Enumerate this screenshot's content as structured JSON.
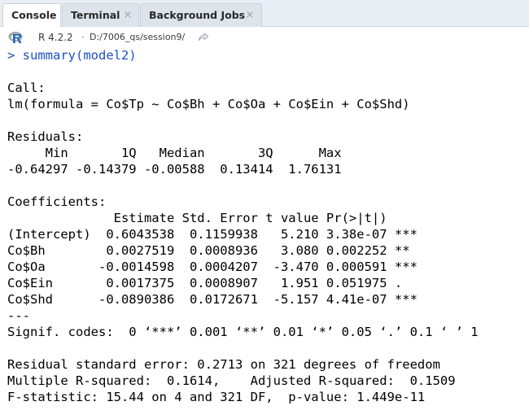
{
  "tabs": [
    {
      "label": "Console",
      "active": true,
      "closable": false
    },
    {
      "label": "Terminal",
      "active": false,
      "closable": true
    },
    {
      "label": "Background Jobs",
      "active": false,
      "closable": true
    }
  ],
  "path_bar": {
    "r_icon": "r-logo-icon",
    "version": "R 4.2.2",
    "separator": "·",
    "path": "D:/7006_qs/session9/",
    "nav_icon": "go-to-directory-icon"
  },
  "console": {
    "prompt_color": "#1d4fbf",
    "lines": [
      {
        "text": "> summary(model2)",
        "kind": "command"
      },
      {
        "text": "",
        "kind": "output"
      },
      {
        "text": "Call:",
        "kind": "output"
      },
      {
        "text": "lm(formula = Co$Tp ~ Co$Bh + Co$Oa + Co$Ein + Co$Shd)",
        "kind": "output"
      },
      {
        "text": "",
        "kind": "output"
      },
      {
        "text": "Residuals:",
        "kind": "output"
      },
      {
        "text": "     Min       1Q   Median       3Q      Max ",
        "kind": "output"
      },
      {
        "text": "-0.64297 -0.14379 -0.00588  0.13414  1.76131 ",
        "kind": "output"
      },
      {
        "text": "",
        "kind": "output"
      },
      {
        "text": "Coefficients:",
        "kind": "output"
      },
      {
        "text": "              Estimate Std. Error t value Pr(>|t|)    ",
        "kind": "output"
      },
      {
        "text": "(Intercept)  0.6043538  0.1159938   5.210 3.38e-07 ***",
        "kind": "output"
      },
      {
        "text": "Co$Bh        0.0027519  0.0008936   3.080 0.002252 ** ",
        "kind": "output"
      },
      {
        "text": "Co$Oa       -0.0014598  0.0004207  -3.470 0.000591 ***",
        "kind": "output"
      },
      {
        "text": "Co$Ein       0.0017375  0.0008907   1.951 0.051975 .  ",
        "kind": "output"
      },
      {
        "text": "Co$Shd      -0.0890386  0.0172671  -5.157 4.41e-07 ***",
        "kind": "output"
      },
      {
        "text": "---",
        "kind": "output"
      },
      {
        "text": "Signif. codes:  0 ‘***’ 0.001 ‘**’ 0.01 ‘*’ 0.05 ‘.’ 0.1 ‘ ’ 1",
        "kind": "output"
      },
      {
        "text": "",
        "kind": "output"
      },
      {
        "text": "Residual standard error: 0.2713 on 321 degrees of freedom",
        "kind": "output"
      },
      {
        "text": "Multiple R-squared:  0.1614,\tAdjusted R-squared:  0.1509 ",
        "kind": "output"
      },
      {
        "text": "F-statistic: 15.44 on 4 and 321 DF,  p-value: 1.449e-11",
        "kind": "output"
      }
    ]
  }
}
